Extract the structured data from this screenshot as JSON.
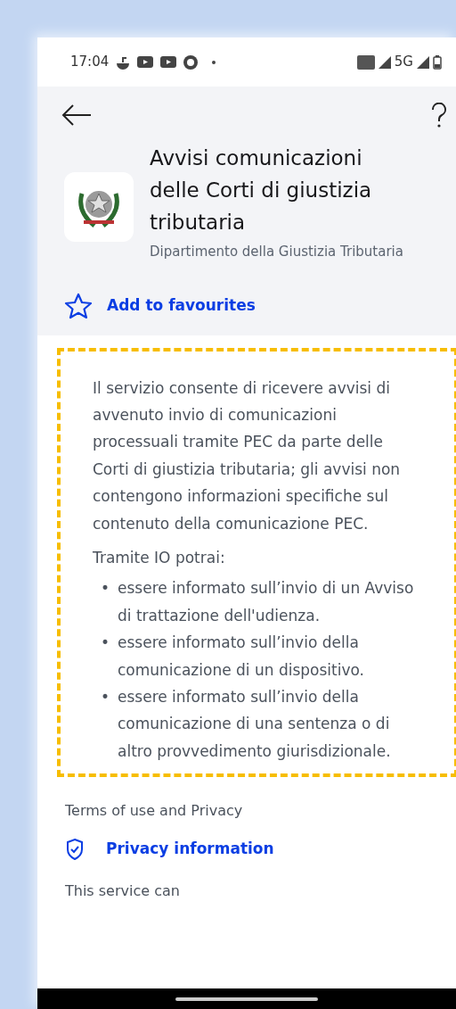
{
  "status_bar": {
    "time": "17:04",
    "network": "5G"
  },
  "service": {
    "title": "Avvisi comunicazioni delle Corti di giustizia tributaria",
    "organization": "Dipartimento della Giustizia Tributaria"
  },
  "favourite": {
    "label": "Add to favourites"
  },
  "description": {
    "paragraph": "Il servizio consente di ricevere avvisi di avvenuto invio di comunicazioni processuali tramite PEC da parte delle Corti di giustizia tributaria; gli avvisi non contengono informazioni specifiche sul contenuto della comunicazione PEC.",
    "intro": "Tramite IO potrai:",
    "items": [
      {
        "marker": "•",
        "text": "essere informato sull’invio di un Avviso di trattazione dell'udienza."
      },
      {
        "marker": "•",
        "text": "essere informato sull’invio della comunicazione di un dispositivo."
      },
      {
        "marker": "•",
        "text": "essere informato sull’invio della comunicazione di una sentenza o di altro provvedimento giurisdizionale."
      }
    ]
  },
  "terms": {
    "heading": "Terms of use and Privacy",
    "privacy_link": "Privacy information"
  },
  "next_section": {
    "heading": "This service can"
  }
}
